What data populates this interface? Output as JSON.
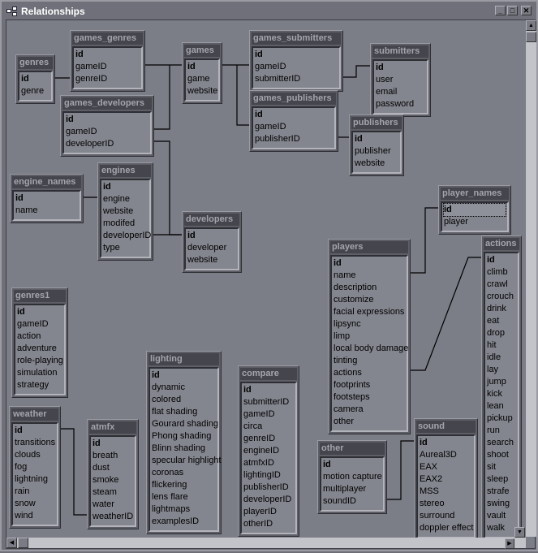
{
  "window": {
    "title": "Relationships",
    "buttons": {
      "minimize": "_",
      "maximize": "□",
      "close": "✕"
    }
  },
  "colors": {
    "workspace": "#7b7d87",
    "table_header": "#45464d",
    "table_body": "#84868f"
  },
  "selected_field": {
    "table": "player_names",
    "field": "id"
  },
  "tables": [
    {
      "name": "genres",
      "fields": [
        "id",
        "genre"
      ]
    },
    {
      "name": "games_genres",
      "fields": [
        "id",
        "gameID",
        "genreID"
      ]
    },
    {
      "name": "games",
      "fields": [
        "id",
        "game",
        "website"
      ]
    },
    {
      "name": "games_submitters",
      "fields": [
        "id",
        "gameID",
        "submitterID"
      ]
    },
    {
      "name": "submitters",
      "fields": [
        "id",
        "user",
        "email",
        "password"
      ]
    },
    {
      "name": "games_publishers",
      "fields": [
        "id",
        "gameID",
        "publisherID"
      ]
    },
    {
      "name": "publishers",
      "fields": [
        "id",
        "publisher",
        "website"
      ]
    },
    {
      "name": "games_developers",
      "fields": [
        "id",
        "gameID",
        "developerID"
      ]
    },
    {
      "name": "engine_names",
      "fields": [
        "id",
        "name"
      ]
    },
    {
      "name": "engines",
      "fields": [
        "id",
        "engine",
        "website",
        "modifed",
        "developerID",
        "type"
      ]
    },
    {
      "name": "developers",
      "fields": [
        "id",
        "developer",
        "website"
      ]
    },
    {
      "name": "player_names",
      "fields": [
        "id",
        "player"
      ]
    },
    {
      "name": "players",
      "fields": [
        "id",
        "name",
        "description",
        "customize",
        "facial expressions",
        "lipsync",
        "limp",
        "local body damage",
        "tinting",
        "actions",
        "footprints",
        "footsteps",
        "camera",
        "other"
      ]
    },
    {
      "name": "actions",
      "fields": [
        "id",
        "climb",
        "crawl",
        "crouch",
        "drink",
        "eat",
        "drop",
        "hit",
        "idle",
        "lay",
        "jump",
        "kick",
        "lean",
        "pickup",
        "run",
        "search",
        "shoot",
        "sit",
        "sleep",
        "strafe",
        "swing",
        "vault",
        "walk"
      ]
    },
    {
      "name": "genres1",
      "fields": [
        "id",
        "gameID",
        "action",
        "adventure",
        "role-playing",
        "simulation",
        "strategy"
      ]
    },
    {
      "name": "lighting",
      "fields": [
        "id",
        "dynamic",
        "colored",
        "flat shading",
        "Gourard shading",
        "Phong shading",
        "Blinn shading",
        "specular highlight",
        "coronas",
        "flickering",
        "lens flare",
        "lightmaps",
        "examplesID"
      ]
    },
    {
      "name": "compare",
      "fields": [
        "id",
        "submitterID",
        "gameID",
        "circa",
        "genreID",
        "engineID",
        "atmfxID",
        "lightingID",
        "publisherID",
        "developerID",
        "playerID",
        "otherID"
      ]
    },
    {
      "name": "weather",
      "fields": [
        "id",
        "transitions",
        "clouds",
        "fog",
        "lightning",
        "rain",
        "snow",
        "wind"
      ]
    },
    {
      "name": "atmfx",
      "fields": [
        "id",
        "breath",
        "dust",
        "smoke",
        "steam",
        "water",
        "weatherID"
      ]
    },
    {
      "name": "other",
      "fields": [
        "id",
        "motion capture",
        "multiplayer",
        "soundID"
      ]
    },
    {
      "name": "sound",
      "fields": [
        "id",
        "Aureal3D",
        "EAX",
        "EAX2",
        "MSS",
        "stereo",
        "surround",
        "doppler effect"
      ]
    }
  ]
}
